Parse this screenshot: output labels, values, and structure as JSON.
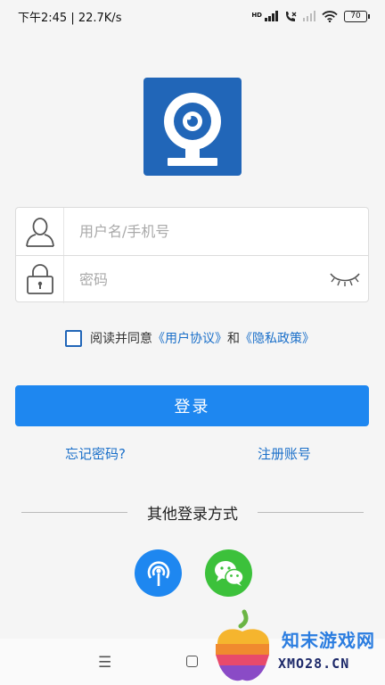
{
  "status_bar": {
    "time_speed": "下午2:45 | 22.7K/s",
    "hd_label": "HD",
    "battery": "70"
  },
  "login": {
    "username_placeholder": "用户名/手机号",
    "password_placeholder": "密码"
  },
  "agreement": {
    "prefix": "阅读并同意",
    "user_agreement": "《用户协议》",
    "conjunction": "和",
    "privacy_policy": "《隐私政策》",
    "checked": false
  },
  "actions": {
    "login_label": "登录",
    "forgot_label": "忘记密码?",
    "register_label": "注册账号"
  },
  "other_login": {
    "label": "其他登录方式"
  },
  "watermark": {
    "title": "知末游戏网",
    "url": "XMO28.CN"
  },
  "colors": {
    "primary": "#1e87f0",
    "logo_bg": "#2166b8",
    "link": "#1a6fc9",
    "wechat": "#3cc13b"
  }
}
